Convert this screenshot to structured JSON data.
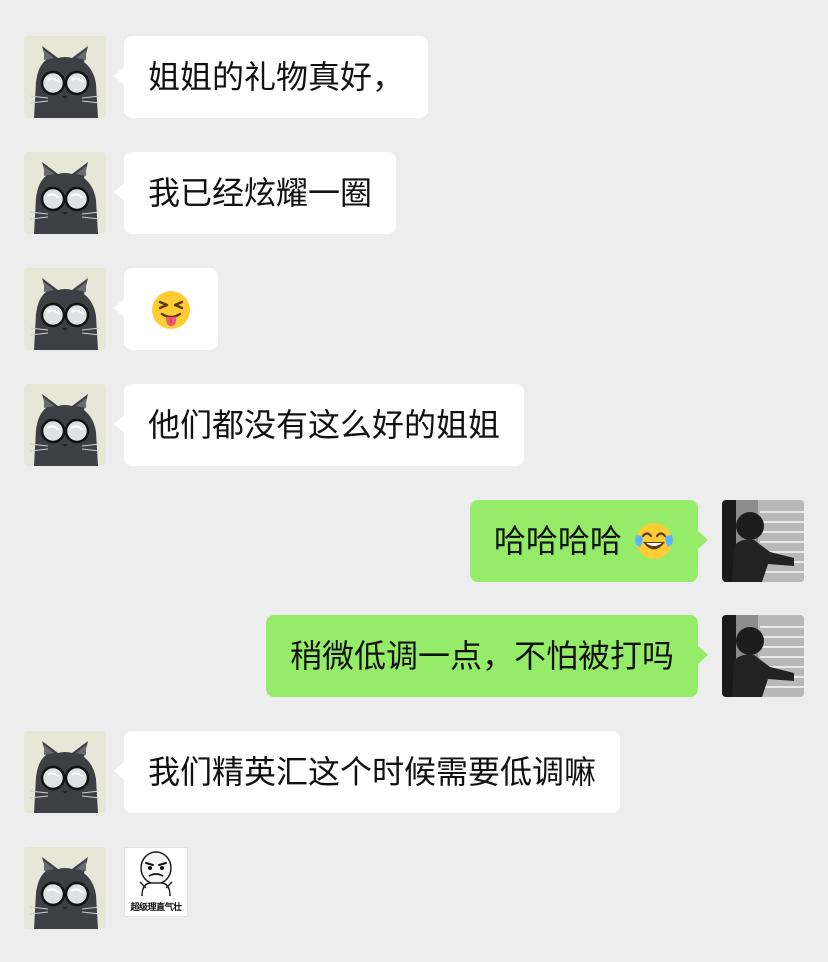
{
  "messages": [
    {
      "side": "in",
      "text": "姐姐的礼物真好，"
    },
    {
      "side": "in",
      "text": "我已经炫耀一圈"
    },
    {
      "side": "in",
      "emoji": "squinting-face-with-tongue"
    },
    {
      "side": "in",
      "text": "他们都没有这么好的姐姐"
    },
    {
      "side": "out",
      "text": "哈哈哈哈",
      "emoji": "face-with-tears-of-joy"
    },
    {
      "side": "out",
      "text": "稍微低调一点，不怕被打吗"
    },
    {
      "side": "in",
      "text": "我们精英汇这个时候需要低调嘛"
    },
    {
      "side": "in",
      "sticker_caption": "超级理直气壮"
    }
  ],
  "colors": {
    "background": "#ededed",
    "incoming_bubble": "#ffffff",
    "outgoing_bubble": "#95ec69"
  },
  "avatars": {
    "incoming": "cat-with-glasses-avatar",
    "outgoing": "person-silhouette-avatar"
  }
}
